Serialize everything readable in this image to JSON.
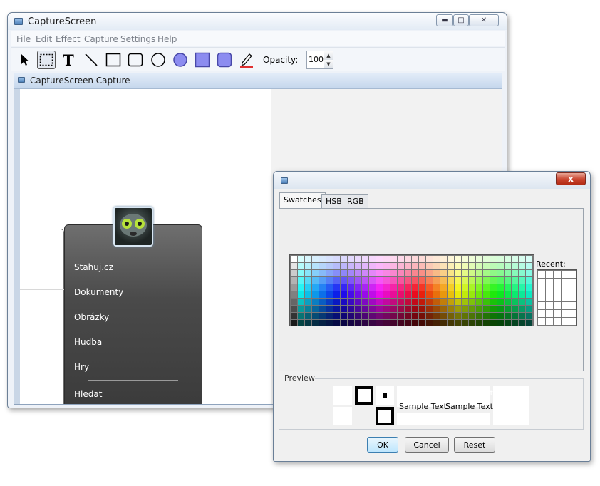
{
  "main_window": {
    "title": "CaptureScreen",
    "menu": [
      "File",
      "Edit",
      "Effect",
      "Capture",
      "Settings",
      "Help"
    ],
    "toolbar": {
      "tools": [
        "arrow-select",
        "rect-select",
        "text",
        "line",
        "rectangle",
        "rounded-rectangle",
        "ellipse",
        "filled-ellipse",
        "filled-rectangle",
        "filled-rounded-rectangle",
        "pen"
      ],
      "text_tool_glyph": "T",
      "opacity_label": "Opacity:",
      "opacity_value": "100"
    },
    "inner_window_title": "CaptureScreen Capture",
    "capture": {
      "start_menu_items": [
        "Stahuj.cz",
        "Dokumenty",
        "Obrázky",
        "Hudba",
        "Hry",
        "Hledat"
      ]
    }
  },
  "color_dialog": {
    "close_glyph": "x",
    "tabs": [
      {
        "label": "Swatches",
        "selected": true
      },
      {
        "label": "HSB",
        "selected": false
      },
      {
        "label": "RGB",
        "selected": false
      }
    ],
    "recent_label": "Recent:",
    "preview_label": "Preview",
    "sample_text": "Sample Text",
    "buttons": {
      "ok": "OK",
      "cancel": "Cancel",
      "reset": "Reset"
    }
  },
  "colors": {
    "tool_fill": "#8c8cf0",
    "tool_fill_border": "#4848a8",
    "pen_underline": "#e03030",
    "recent_swatch": "#ffffff"
  }
}
